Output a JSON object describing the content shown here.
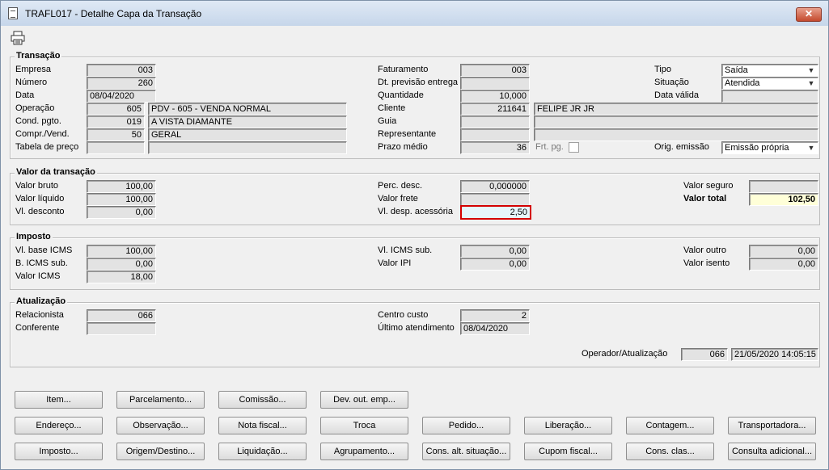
{
  "window": {
    "title": "TRAFL017 - Detalhe Capa da Transação",
    "close": "✕"
  },
  "toolbar": {
    "print_icon": "printer-icon"
  },
  "transacao": {
    "title": "Transação",
    "empresa_label": "Empresa",
    "empresa": "003",
    "numero_label": "Número",
    "numero": "260",
    "data_label": "Data",
    "data": "08/04/2020",
    "operacao_label": "Operação",
    "operacao_cod": "605",
    "operacao_desc": "PDV - 605 - VENDA NORMAL",
    "cond_label": "Cond. pgto.",
    "cond_cod": "019",
    "cond_desc": "A VISTA DIAMANTE",
    "compr_label": "Compr./Vend.",
    "compr_cod": "50",
    "compr_desc": "GERAL",
    "tabela_label": "Tabela de preço",
    "tabela_cod": "",
    "tabela_desc": "",
    "faturamento_label": "Faturamento",
    "faturamento": "003",
    "dtprev_label": "Dt. previsão entrega",
    "dtprev": "",
    "quantidade_label": "Quantidade",
    "quantidade": "10,000",
    "cliente_label": "Cliente",
    "cliente_cod": "211641",
    "cliente_nome": "FELIPE JR JR",
    "guia_label": "Guia",
    "guia": "",
    "guia_desc": "",
    "repr_label": "Representante",
    "repr": "",
    "repr_desc": "",
    "prazo_label": "Prazo médio",
    "prazo": "36",
    "frt_label": "Frt. pg.",
    "tipo_label": "Tipo",
    "tipo": "Saída",
    "situacao_label": "Situação",
    "situacao": "Atendida",
    "datavalida_label": "Data válida",
    "datavalida": "",
    "orig_label": "Orig. emissão",
    "orig": "Emissão própria"
  },
  "valor": {
    "title": "Valor da transação",
    "bruto_label": "Valor bruto",
    "bruto": "100,00",
    "liquido_label": "Valor líquido",
    "liquido": "100,00",
    "desconto_label": "Vl. desconto",
    "desconto": "0,00",
    "percdesc_label": "Perc. desc.",
    "percdesc": "0,000000",
    "frete_label": "Valor frete",
    "frete": "",
    "despacess_label": "Vl. desp. acessória",
    "despacess": "2,50",
    "seguro_label": "Valor seguro",
    "seguro": "",
    "total_label": "Valor total",
    "total": "102,50"
  },
  "imposto": {
    "title": "Imposto",
    "baseicms_label": "Vl. base ICMS",
    "baseicms": "100,00",
    "bicmssub_label": "B. ICMS sub.",
    "bicmssub": "0,00",
    "valoricms_label": "Valor ICMS",
    "valoricms": "18,00",
    "vlicmssub_label": "Vl. ICMS sub.",
    "vlicmssub": "0,00",
    "valoripi_label": "Valor IPI",
    "valoripi": "0,00",
    "outro_label": "Valor outro",
    "outro": "0,00",
    "isento_label": "Valor isento",
    "isento": "0,00"
  },
  "atualizacao": {
    "title": "Atualização",
    "relacionista_label": "Relacionista",
    "relacionista": "066",
    "conferente_label": "Conferente",
    "conferente": "",
    "centro_label": "Centro custo",
    "centro": "2",
    "ultimo_label": "Último atendimento",
    "ultimo": "08/04/2020",
    "operador_label": "Operador/Atualização",
    "operador": "066",
    "operador_data": "21/05/2020 14:05:15"
  },
  "buttons": {
    "row1": [
      "Item...",
      "Parcelamento...",
      "Comissão...",
      "Dev. out. emp..."
    ],
    "row2": [
      "Endereço...",
      "Observação...",
      "Nota fiscal...",
      "Troca",
      "Pedido...",
      "Liberação...",
      "Contagem...",
      "Transportadora..."
    ],
    "row3": [
      "Imposto...",
      "Origem/Destino...",
      "Liquidação...",
      "Agrupamento...",
      "Cons. alt. situação...",
      "Cupom fiscal...",
      "Cons. clas...",
      "Consulta adicional..."
    ]
  }
}
